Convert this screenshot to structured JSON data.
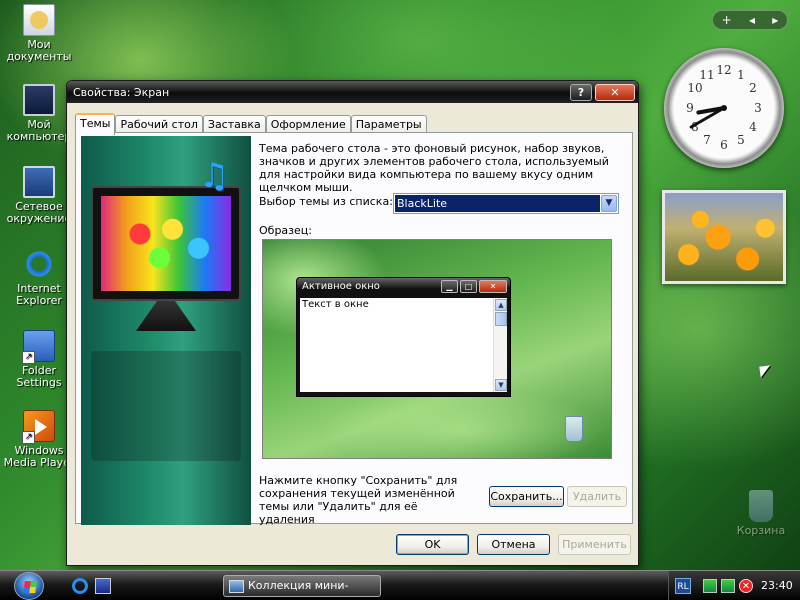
{
  "desktop": {
    "icons": [
      {
        "label": "Мои документы"
      },
      {
        "label": "Мой компьютер"
      },
      {
        "label": "Сетевое окружение"
      },
      {
        "label": "Internet Explorer"
      },
      {
        "label": "Folder Settings"
      },
      {
        "label": "Windows Media Player"
      },
      {
        "label": "Корзина"
      }
    ]
  },
  "gadgets": {
    "bar": {
      "add": "+",
      "prev": "◂",
      "next": "▸"
    },
    "clock": {
      "hours": 8,
      "minutes": 40
    }
  },
  "window": {
    "title": "Свойства: Экран",
    "help_btn": "?",
    "close_btn": "✕",
    "tabs": [
      {
        "label": "Темы",
        "active": true
      },
      {
        "label": "Рабочий стол"
      },
      {
        "label": "Заставка"
      },
      {
        "label": "Оформление"
      },
      {
        "label": "Параметры"
      }
    ],
    "description": "Тема рабочего стола - это фоновый рисунок, набор звуков, значков и других элементов рабочего стола, используемый для настройки вида компьютера по вашему вкусу одним щелчком мыши.",
    "theme_label": "Выбор темы из списка:",
    "theme_value": "BlackLite",
    "sample_label": "Образец:",
    "preview": {
      "window_title": "Активное окно",
      "window_text": "Текст в окне"
    },
    "save_hint": "Нажмите кнопку \"Сохранить\" для сохранения текущей изменённой темы или \"Удалить\" для её удаления",
    "buttons": {
      "save": "Сохранить...",
      "delete": "Удалить",
      "ok": "OK",
      "cancel": "Отмена",
      "apply": "Применить"
    }
  },
  "taskbar": {
    "task_label": "Коллекция мини-при...",
    "lang": "RL",
    "time": "23:40"
  },
  "colors": {
    "selection": "#0a246a",
    "window_face": "#ece9d8",
    "titlebar": "#0c0c0c",
    "close_button": "#b32a10"
  }
}
